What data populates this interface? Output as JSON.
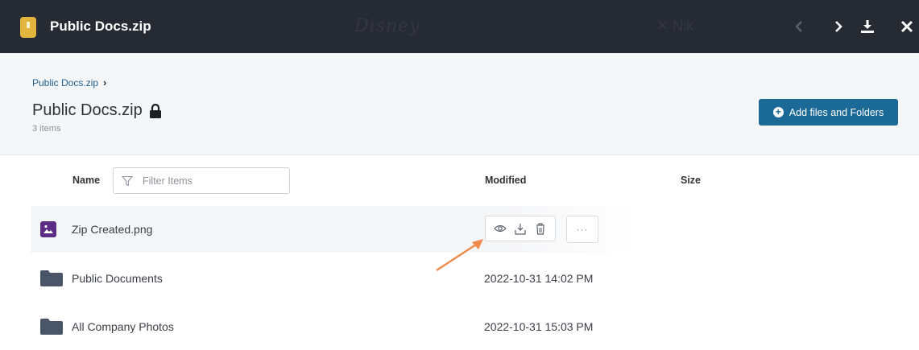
{
  "viewer": {
    "title": "Public Docs.zip",
    "background_logo_text": "Disney",
    "background_close_text": "✕ Nik"
  },
  "header": {
    "breadcrumb": "Public Docs.zip",
    "title": "Public Docs.zip",
    "item_count": "3 items",
    "add_button_label": "Add files and Folders"
  },
  "table": {
    "columns": {
      "name": "Name",
      "modified": "Modified",
      "size": "Size"
    },
    "filter_placeholder": "Filter Items",
    "rows": [
      {
        "name": "Zip Created.png",
        "type": "image",
        "modified": "",
        "size": ""
      },
      {
        "name": "Public Documents",
        "type": "folder",
        "modified": "2022-10-31 14:02 PM",
        "size": ""
      },
      {
        "name": "All Company Photos",
        "type": "folder",
        "modified": "2022-10-31 15:03 PM",
        "size": ""
      }
    ],
    "more_label": "···"
  },
  "colors": {
    "topbar": "#262a32",
    "accent_button": "#1a6996",
    "folder": "#4a5568",
    "image_icon": "#5c2c84",
    "annotation_arrow": "#f08a4b"
  },
  "icons": {
    "row_actions": [
      "preview-eye-icon",
      "download-icon",
      "trash-icon"
    ],
    "top_actions": [
      "chevron-left-icon",
      "chevron-right-icon",
      "download-icon",
      "close-icon"
    ]
  }
}
